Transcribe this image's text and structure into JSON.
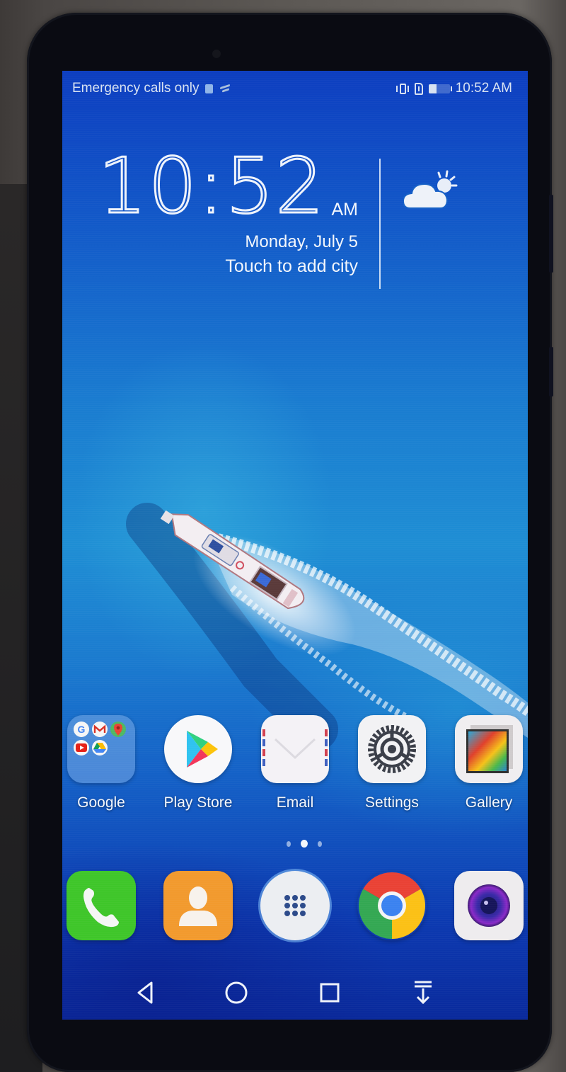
{
  "status_bar": {
    "carrier_text": "Emergency calls only",
    "left_icons": [
      "sim-icon",
      "wifi-icon"
    ],
    "right_icons": [
      "vibrate-icon",
      "no-sim-icon",
      "battery-icon"
    ],
    "battery_level_percent": 35,
    "time": "10:52 AM"
  },
  "clock_widget": {
    "time": "10:52",
    "ampm": "AM",
    "date": "Monday, July 5",
    "city_prompt": "Touch to add city",
    "weather_icon": "partly-cloudy-icon"
  },
  "wallpaper": {
    "description": "Aerial view of a white boat cruising across blue ocean"
  },
  "home_apps": [
    {
      "label": "Google",
      "icon": "google-folder-icon",
      "folder_apps": [
        "google-icon",
        "gmail-icon",
        "maps-icon",
        "youtube-icon",
        "drive-icon"
      ]
    },
    {
      "label": "Play Store",
      "icon": "play-store-icon"
    },
    {
      "label": "Email",
      "icon": "email-icon"
    },
    {
      "label": "Settings",
      "icon": "settings-gear-icon"
    },
    {
      "label": "Gallery",
      "icon": "gallery-icon"
    }
  ],
  "page_indicator": {
    "pages": 3,
    "current_page": 2
  },
  "dock_apps": [
    {
      "name": "Phone",
      "icon": "phone-icon"
    },
    {
      "name": "Contacts",
      "icon": "contacts-icon"
    },
    {
      "name": "App Drawer",
      "icon": "app-drawer-icon"
    },
    {
      "name": "Chrome",
      "icon": "chrome-icon"
    },
    {
      "name": "Camera",
      "icon": "camera-icon"
    }
  ],
  "nav_bar": {
    "buttons": [
      "back",
      "home",
      "recents",
      "notification-pull-down"
    ]
  },
  "colors": {
    "phone_green": "#3fc62a",
    "contacts_orange": "#f29a2e",
    "ocean_blue": "#1a7cd0",
    "text_white": "#f2f6fc"
  }
}
